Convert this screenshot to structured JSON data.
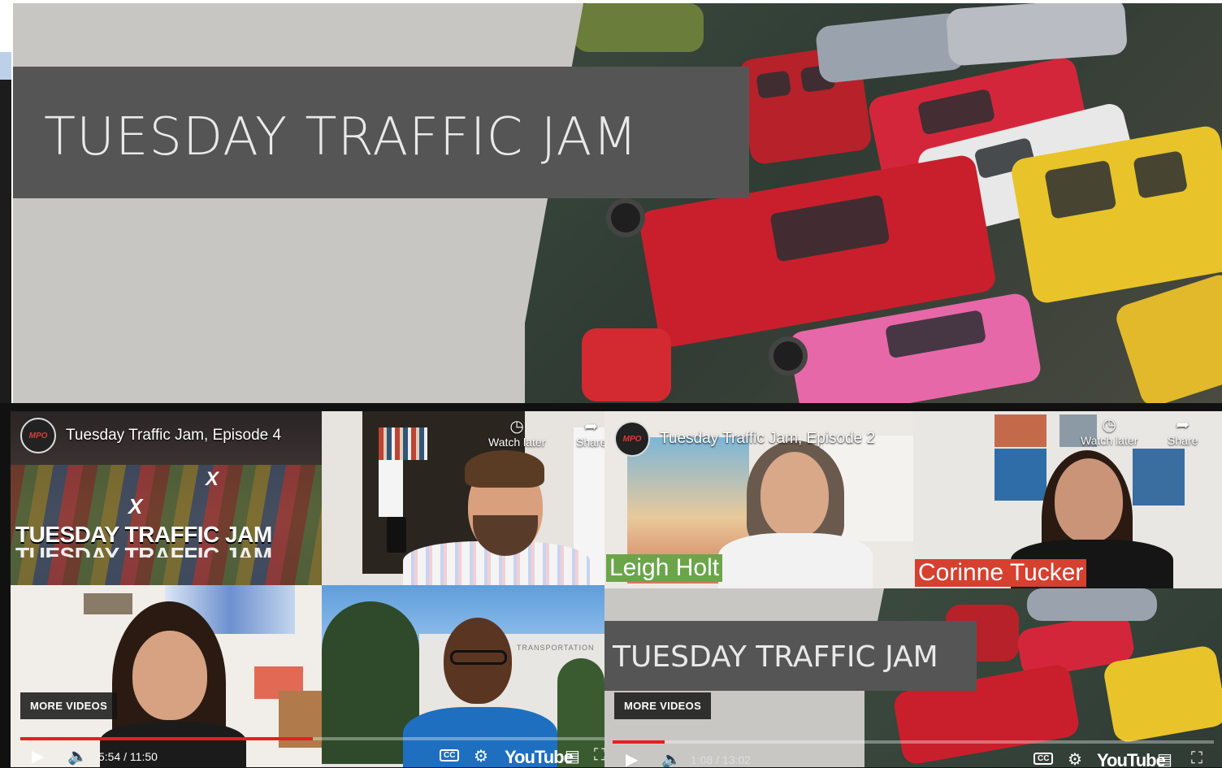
{
  "hero": {
    "title": "TUESDAY TRAFFIC JAM"
  },
  "videos": [
    {
      "channel_logo": "MPO",
      "title": "Tuesday Traffic Jam, Episode 4",
      "watch_later_label": "Watch later",
      "share_label": "Share",
      "thumbnail_title": "TUESDAY TRAFFIC JAM",
      "thumbnail_x": "X",
      "more_videos_label": "MORE VIDEOS",
      "time": "5:54 / 11:50",
      "progress": 0.5
    },
    {
      "channel_logo": "MPO",
      "title": "Tuesday Traffic Jam, Episode 2",
      "watch_later_label": "Watch later",
      "share_label": "Share",
      "speaker_left": "Leigh Holt",
      "speaker_right": "Corinne Tucker",
      "slide_title": "TUESDAY TRAFFIC JAM",
      "more_videos_label": "MORE VIDEOS",
      "time": "1:08 / 13:02",
      "progress": 0.087
    }
  ],
  "player": {
    "youtube_label": "YouTube",
    "icons": [
      "play-icon",
      "volume-icon",
      "cc-icon",
      "settings-icon",
      "cast-icon",
      "fullscreen-icon",
      "clock-icon",
      "share-icon"
    ]
  },
  "colors": {
    "hero_band": "#555555",
    "progress": "#e52020",
    "name_tag_left": "#6aa54a",
    "name_tag_right": "#d6402f"
  }
}
